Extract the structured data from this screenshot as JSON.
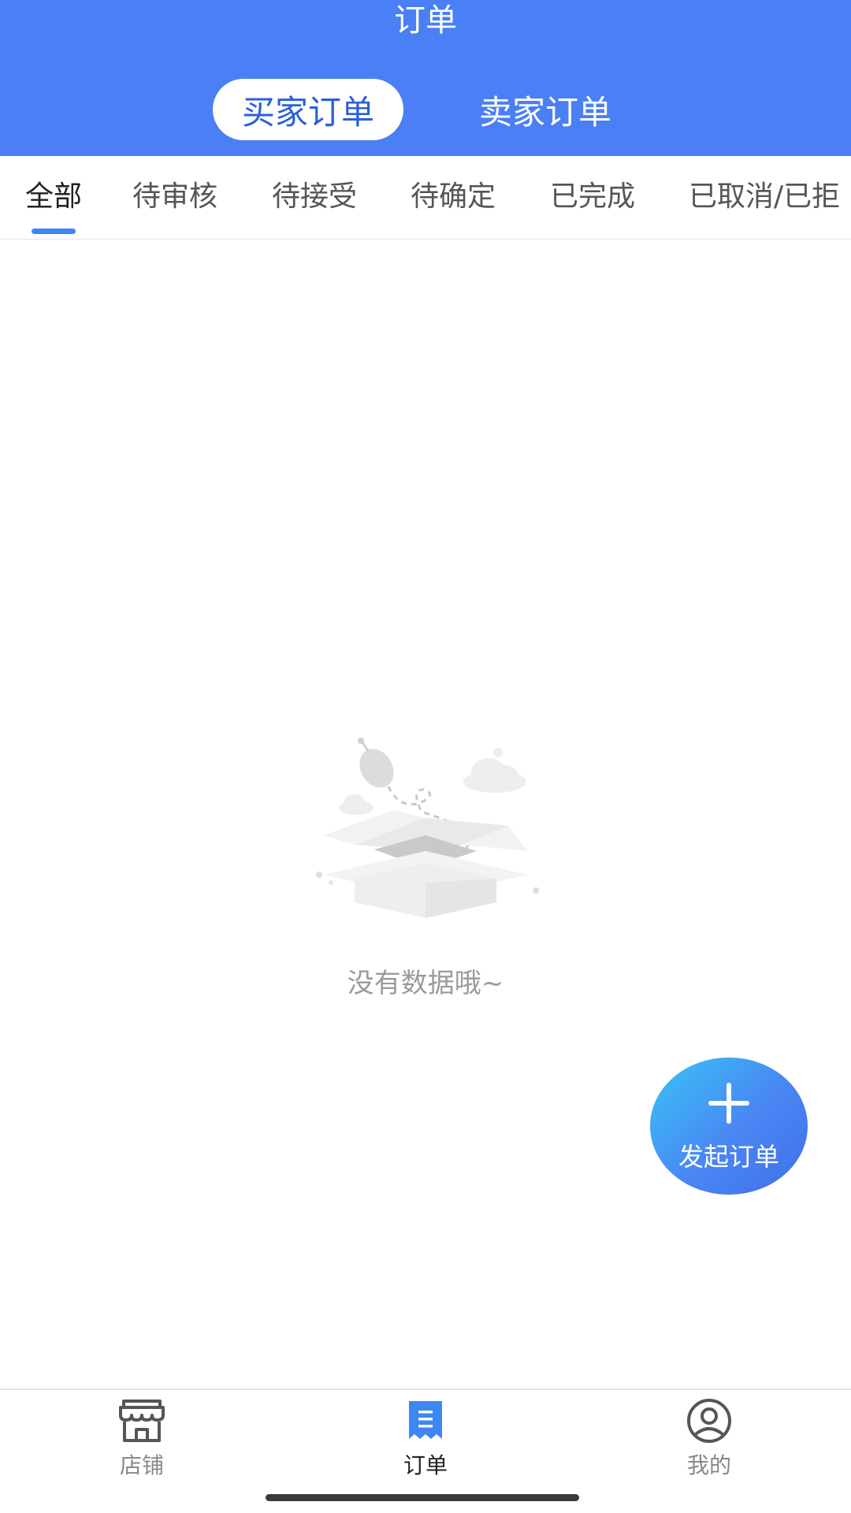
{
  "header": {
    "title": "订单",
    "segments": [
      {
        "label": "买家订单",
        "active": true
      },
      {
        "label": "卖家订单",
        "active": false
      }
    ]
  },
  "tabs": [
    {
      "label": "全部",
      "active": true
    },
    {
      "label": "待审核"
    },
    {
      "label": "待接受"
    },
    {
      "label": "待确定"
    },
    {
      "label": "已完成"
    },
    {
      "label": "已取消/已拒"
    }
  ],
  "empty_state": {
    "message": "没有数据哦~",
    "icon": "empty-box-icon"
  },
  "fab": {
    "label": "发起订单",
    "icon": "plus-icon"
  },
  "bottom_nav": [
    {
      "label": "店铺",
      "icon": "store-icon",
      "active": false
    },
    {
      "label": "订单",
      "icon": "order-list-icon",
      "active": true
    },
    {
      "label": "我的",
      "icon": "user-icon",
      "active": false
    }
  ],
  "colors": {
    "primary": "#4a7ff5",
    "segment_text_active": "#2b5fd9",
    "tab_indicator": "#3e86f5",
    "nav_active_icon": "#3e86f5",
    "empty_text": "#9a9a9a"
  }
}
